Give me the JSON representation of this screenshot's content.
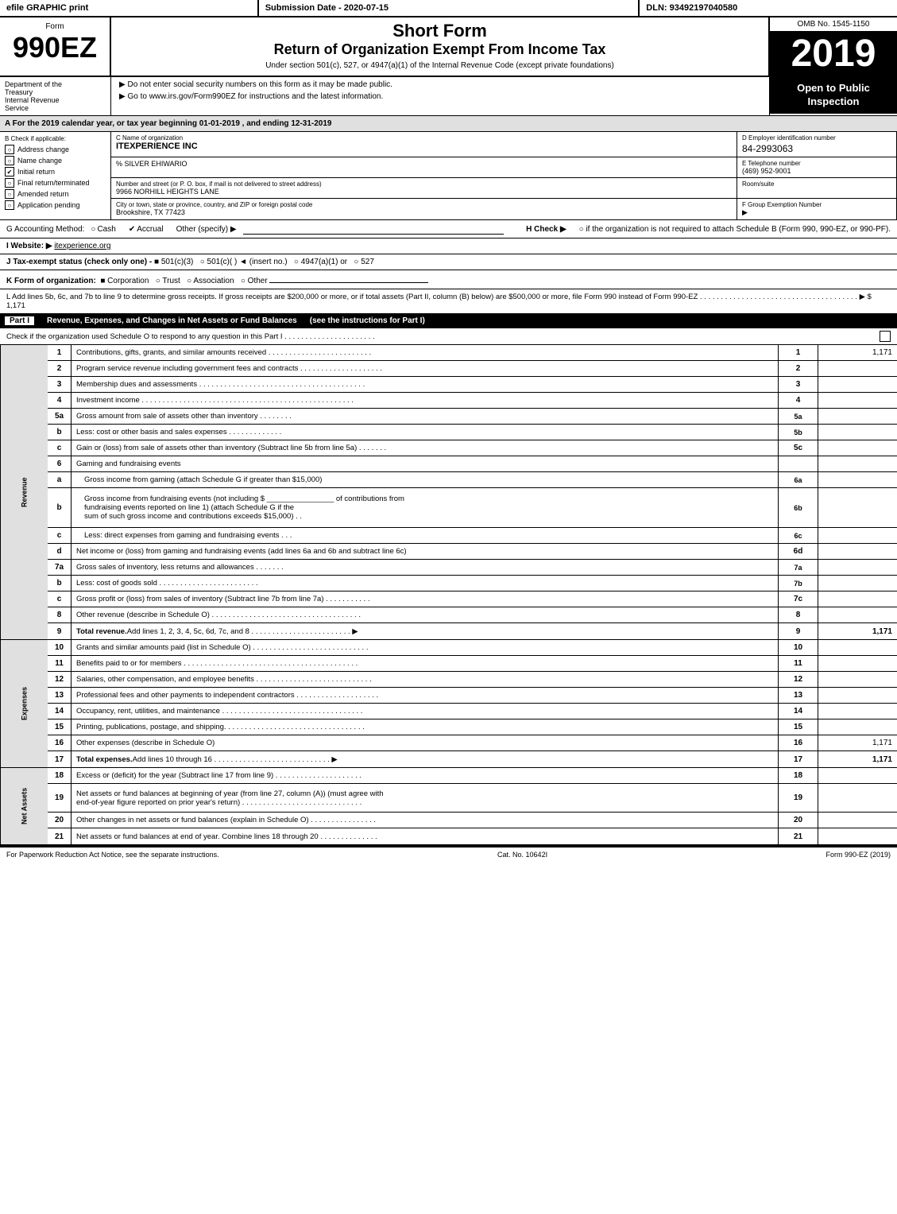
{
  "topbar": {
    "left": "efile GRAPHIC print",
    "mid": "Submission Date - 2020-07-15",
    "right": "DLN: 93492197040580"
  },
  "form": {
    "number": "990EZ",
    "sub": "Form",
    "title": "Short Form",
    "subtitle": "Return of Organization Exempt From Income Tax",
    "under_text": "Under section 501(c), 527, or 4947(a)(1) of the Internal Revenue Code (except private foundations)",
    "do_not": "▶ Do not enter social security numbers on this form as it may be made public.",
    "goto": "▶ Go to www.irs.gov/Form990EZ for instructions and the latest information.",
    "omb": "OMB No. 1545-1150",
    "year": "2019",
    "open_to_public": "Open to\nPublic\nInspection"
  },
  "dept": {
    "line1": "Department of the",
    "line2": "Treasury",
    "line3": "Internal Revenue",
    "line4": "Service"
  },
  "section_a": {
    "text": "A  For the 2019 calendar year, or tax year beginning 01-01-2019 , and ending 12-31-2019"
  },
  "check_items": {
    "b_label": "B Check if applicable:",
    "items": [
      {
        "label": "Address change",
        "checked": false
      },
      {
        "label": "Name change",
        "checked": false
      },
      {
        "label": "Initial return",
        "checked": false
      },
      {
        "label": "Final return/terminated",
        "checked": false
      },
      {
        "label": "Amended return",
        "checked": false
      },
      {
        "label": "Application pending",
        "checked": false
      }
    ]
  },
  "org": {
    "c_label": "C Name of organization",
    "name": "ITEXPERIENCE INC",
    "attention": "% SILVER EHIWARIO",
    "street_label": "Number and street (or P. O. box, if mail is not delivered to street address)",
    "street": "9966 NORHILL HEIGHTS LANE",
    "room_label": "Room/suite",
    "room": "",
    "city_label": "City or town, state or province, country, and ZIP or foreign postal code",
    "city": "Brookshire, TX  77423",
    "d_label": "D Employer identification number",
    "ein": "84-2993063",
    "e_label": "E Telephone number",
    "phone": "(469) 952-9001",
    "f_label": "F Group Exemption",
    "f_sub": "Number",
    "f_arrow": "▶"
  },
  "acct": {
    "g_label": "G Accounting Method:",
    "cash": "Cash",
    "accrual": "Accrual",
    "accrual_checked": true,
    "other": "Other (specify) ▶",
    "h_label": "H  Check ▶",
    "h_text": "○ if the organization is not required to attach Schedule B (Form 990, 990-EZ, or 990-PF)."
  },
  "website": {
    "i_label": "I Website: ▶",
    "url": "itexperience.org"
  },
  "tax_status": {
    "j_label": "J Tax-exempt status (check only one) -",
    "options": [
      "✔ 501(c)(3)",
      "○ 501(c)(  ) ◄ (insert no.)",
      "○ 4947(a)(1) or",
      "○ 527"
    ]
  },
  "form_org": {
    "k_label": "K Form of organization:",
    "options": [
      "✔ Corporation",
      "○ Trust",
      "○ Association",
      "○ Other"
    ]
  },
  "line_l": {
    "text": "L Add lines 5b, 6c, and 7b to line 9 to determine gross receipts. If gross receipts are $200,000 or more, or if total assets (Part II, column (B) below) are $500,000 or more, file Form 990 instead of Form 990-EZ . . . . . . . . . . . . . . . . . . . . . . . . . . . . . . . . . . . . . . ▶ $ 1,171"
  },
  "part1": {
    "label": "Part I",
    "title": "Revenue, Expenses, and Changes in Net Assets or Fund Balances",
    "see_instructions": "(see the instructions for Part I)",
    "check_line": "Check if the organization used Schedule O to respond to any question in this Part I . . . . . . . . . . . . . . . . . . . . . .",
    "checkbox": "☐"
  },
  "revenue_rows": [
    {
      "num": "1",
      "desc": "Contributions, gifts, grants, and similar amounts received . . . . . . . . . . . . . . . . . . . . . . . . .",
      "line": "1",
      "amount": "1,171"
    },
    {
      "num": "2",
      "desc": "Program service revenue including government fees and contracts . . . . . . . . . . . . . . . . . . . .",
      "line": "2",
      "amount": ""
    },
    {
      "num": "3",
      "desc": "Membership dues and assessments . . . . . . . . . . . . . . . . . . . . . . . . . . . . . . . . . . . . . . . .",
      "line": "3",
      "amount": ""
    },
    {
      "num": "4",
      "desc": "Investment income . . . . . . . . . . . . . . . . . . . . . . . . . . . . . . . . . . . . . . . . . . . . . . . . . . .",
      "line": "4",
      "amount": ""
    },
    {
      "num": "5a",
      "desc": "Gross amount from sale of assets other than inventory . . . . . . . .",
      "sub": "5a",
      "amount": ""
    },
    {
      "num": "5b",
      "desc": "Less: cost or other basis and sales expenses . . . . . . . . . . . . .",
      "sub": "5b",
      "amount": ""
    },
    {
      "num": "5c",
      "desc": "Gain or (loss) from sale of assets other than inventory (Subtract line 5b from line 5a) . . . . . . .",
      "line": "5c",
      "amount": ""
    },
    {
      "num": "6",
      "desc": "Gaming and fundraising events",
      "line": "",
      "amount": ""
    },
    {
      "num": "6a",
      "desc": "Gross income from gaming (attach Schedule G if greater than $15,000)",
      "sub": "6a",
      "amount": "",
      "indent": true
    },
    {
      "num": "6b",
      "desc": "Gross income from fundraising events (not including $ ________________ of contributions from fundraising events reported on line 1) (attach Schedule G if the sum of such gross income and contributions exceeds $15,000)  . .",
      "sub": "6b",
      "amount": "",
      "indent": true
    },
    {
      "num": "6c",
      "desc": "Less: direct expenses from gaming and fundraising events  . . .",
      "sub": "6c",
      "amount": "",
      "indent": true
    },
    {
      "num": "6d",
      "desc": "Net income or (loss) from gaming and fundraising events (add lines 6a and 6b and subtract line 6c)",
      "line": "6d",
      "amount": ""
    },
    {
      "num": "7a",
      "desc": "Gross sales of inventory, less returns and allowances . . . . . . .",
      "sub": "7a",
      "amount": ""
    },
    {
      "num": "7b",
      "desc": "Less: cost of goods sold . . . . . . . . . . . . . . . . . . . . . . . .",
      "sub": "7b",
      "amount": ""
    },
    {
      "num": "7c",
      "desc": "Gross profit or (loss) from sales of inventory (Subtract line 7b from line 7a) . . . . . . . . . . .",
      "line": "7c",
      "amount": ""
    },
    {
      "num": "8",
      "desc": "Other revenue (describe in Schedule O) . . . . . . . . . . . . . . . . . . . . . . . . . . . . . . . . . . . .",
      "line": "8",
      "amount": ""
    },
    {
      "num": "9",
      "desc": "Total revenue. Add lines 1, 2, 3, 4, 5c, 6d, 7c, and 8 . . . . . . . . . . . . . . . . . . . . . . . . ▶",
      "line": "9",
      "amount": "1,171",
      "bold": true
    }
  ],
  "expense_rows": [
    {
      "num": "10",
      "desc": "Grants and similar amounts paid (list in Schedule O) . . . . . . . . . . . . . . . . . . . . . . . . . . . .",
      "line": "10",
      "amount": ""
    },
    {
      "num": "11",
      "desc": "Benefits paid to or for members . . . . . . . . . . . . . . . . . . . . . . . . . . . . . . . . . . . . . . . . . .",
      "line": "11",
      "amount": ""
    },
    {
      "num": "12",
      "desc": "Salaries, other compensation, and employee benefits . . . . . . . . . . . . . . . . . . . . . . . . . . . .",
      "line": "12",
      "amount": ""
    },
    {
      "num": "13",
      "desc": "Professional fees and other payments to independent contractors . . . . . . . . . . . . . . . . . . . .",
      "line": "13",
      "amount": ""
    },
    {
      "num": "14",
      "desc": "Occupancy, rent, utilities, and maintenance . . . . . . . . . . . . . . . . . . . . . . . . . . . . . . . . . .",
      "line": "14",
      "amount": ""
    },
    {
      "num": "15",
      "desc": "Printing, publications, postage, and shipping. . . . . . . . . . . . . . . . . . . . . . . . . . . . . . . . . .",
      "line": "15",
      "amount": ""
    },
    {
      "num": "16",
      "desc": "Other expenses (describe in Schedule O)",
      "line": "16",
      "amount": "1,171"
    },
    {
      "num": "17",
      "desc": "Total expenses. Add lines 10 through 16  . . . . . . . . . . . . . . . . . . . . . . . . . . . . ▶",
      "line": "17",
      "amount": "1,171",
      "bold": true
    }
  ],
  "net_assets_rows": [
    {
      "num": "18",
      "desc": "Excess or (deficit) for the year (Subtract line 17 from line 9)  . . . . . . . . . . . . . . . . . . . . .",
      "line": "18",
      "amount": ""
    },
    {
      "num": "19",
      "desc": "Net assets or fund balances at beginning of year (from line 27, column (A)) (must agree with end-of-year figure reported on prior year's return) . . . . . . . . . . . . . . . . . . . . . . . . . . . . .",
      "line": "19",
      "amount": "",
      "multiline": true
    },
    {
      "num": "20",
      "desc": "Other changes in net assets or fund balances (explain in Schedule O) . . . . . . . . . . . . . . . .",
      "line": "20",
      "amount": ""
    },
    {
      "num": "21",
      "desc": "Net assets or fund balances at end of year. Combine lines 18 through 20 . . . . . . . . . . . . . .",
      "line": "21",
      "amount": ""
    }
  ],
  "footer": {
    "left": "For Paperwork Reduction Act Notice, see the separate instructions.",
    "mid": "Cat. No. 10642I",
    "right": "Form 990-EZ (2019)"
  }
}
